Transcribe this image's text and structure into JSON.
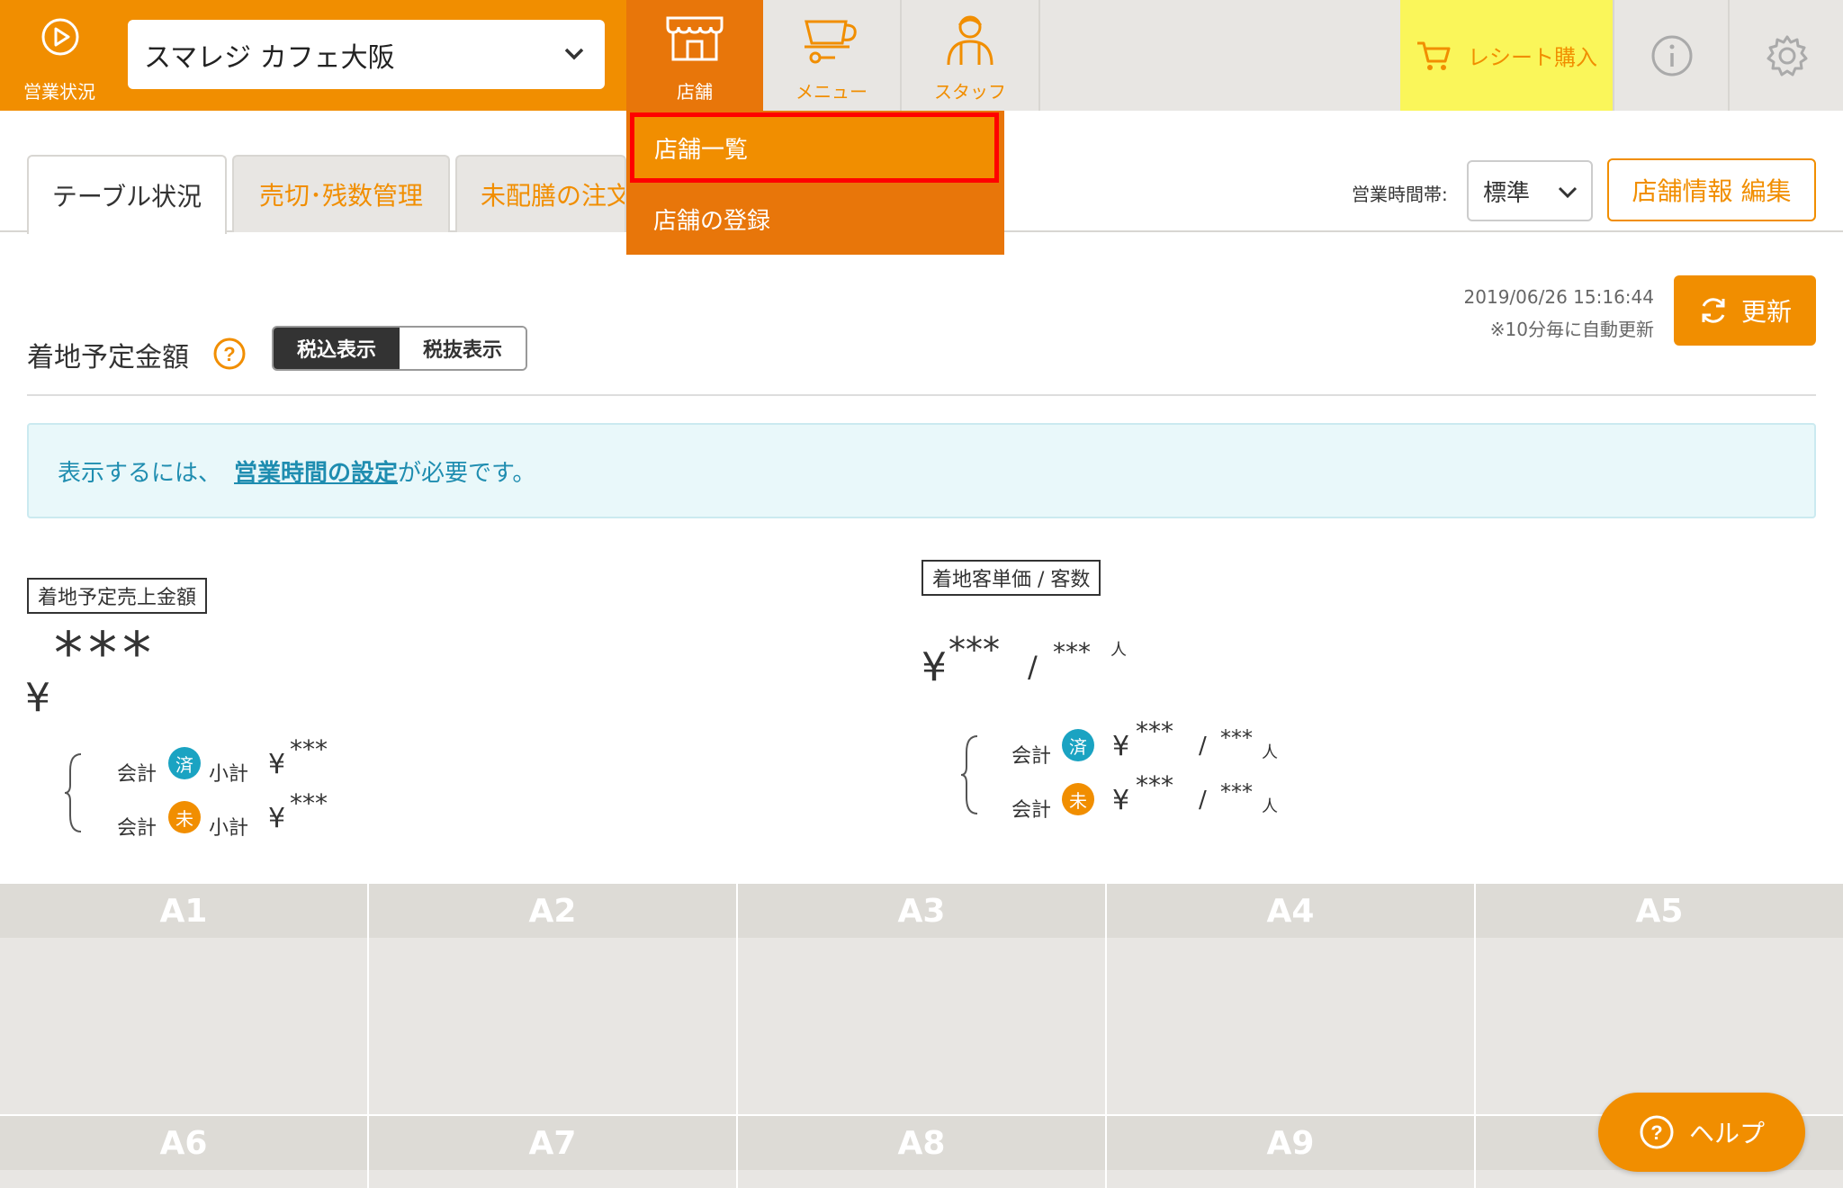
{
  "header": {
    "status_label": "営業状況",
    "store_name": "スマレジ カフェ大阪",
    "nav": [
      {
        "label": "店舗",
        "icon": "storefront-icon"
      },
      {
        "label": "メニュー",
        "icon": "cup-icon"
      },
      {
        "label": "スタッフ",
        "icon": "staff-icon"
      }
    ],
    "receipt_label": "レシート購入",
    "colors": {
      "accent": "#f18e00",
      "active": "#e8760a",
      "receipt_bg": "#faf65a"
    }
  },
  "dropdown": {
    "items": [
      "店舗一覧",
      "店舗の登録"
    ]
  },
  "tabs": [
    "テーブル状況",
    "売切･残数管理",
    "未配膳の注文"
  ],
  "time_band": {
    "label": "営業時間帯:",
    "value": "標準"
  },
  "edit_store_label": "店舗情報 編集",
  "update": {
    "timestamp": "2019/06/26 15:16:44",
    "note": "※10分毎に自動更新",
    "button_label": "更新"
  },
  "expected": {
    "title": "着地予定金額",
    "tax_incl": "税込表示",
    "tax_excl": "税抜表示"
  },
  "notice": {
    "prefix": "表示するには、",
    "link": "営業時間の設定",
    "suffix": "が必要です。"
  },
  "sales": {
    "label": "着地予定売上金額",
    "yen": "¥",
    "value": "***",
    "rows": [
      {
        "pre": "会計",
        "badge": "済",
        "post": "小計",
        "yen": "¥",
        "value": "***"
      },
      {
        "pre": "会計",
        "badge": "未",
        "post": "小計",
        "yen": "¥",
        "value": "***"
      }
    ]
  },
  "per_customer": {
    "label": "着地客単価 / 客数",
    "yen": "¥",
    "value": "***",
    "slash": "/",
    "count": "***",
    "unit": "人",
    "rows": [
      {
        "pre": "会計",
        "badge": "済",
        "yen": "¥",
        "value": "***",
        "slash": "/",
        "count": "***",
        "unit": "人"
      },
      {
        "pre": "会計",
        "badge": "未",
        "yen": "¥",
        "value": "***",
        "slash": "/",
        "count": "***",
        "unit": "人"
      }
    ]
  },
  "tables": [
    "A1",
    "A2",
    "A3",
    "A4",
    "A5",
    "A6",
    "A7",
    "A8",
    "A9"
  ],
  "help_label": "ヘルプ"
}
